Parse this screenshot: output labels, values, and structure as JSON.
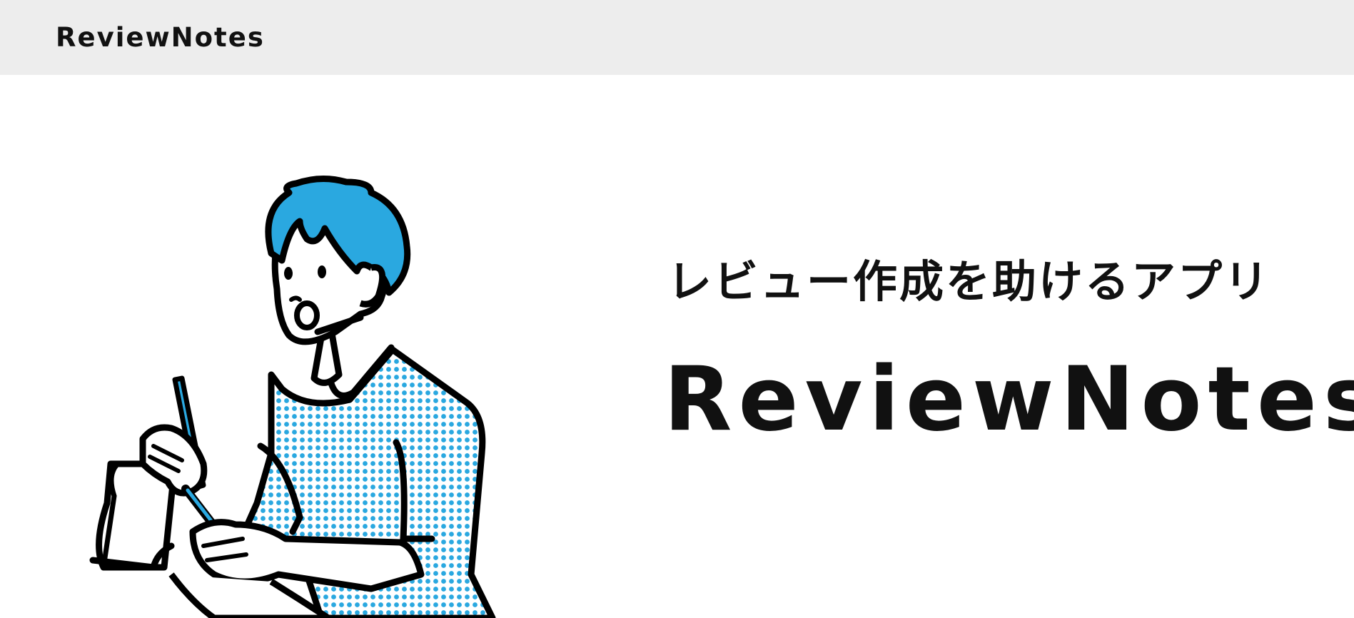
{
  "header": {
    "brand": "ReviewNotes"
  },
  "hero": {
    "tagline": "レビュー作成を助けるアプリ",
    "title": "ReviewNotes",
    "illustration_icon": "person-writing-notes-illustration"
  },
  "colors": {
    "header_bg": "#ededed",
    "accent_blue": "#2aa8e0",
    "text": "#111111"
  }
}
